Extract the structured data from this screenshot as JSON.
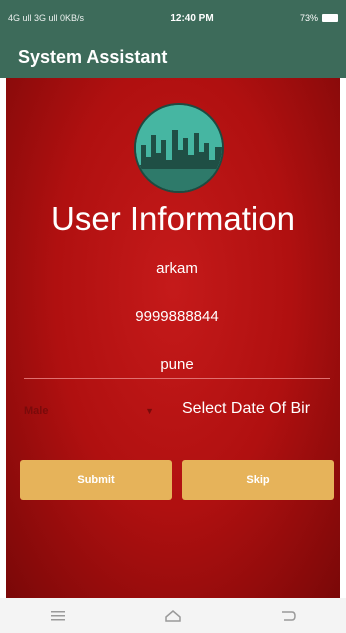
{
  "status_bar": {
    "left_text": "4G ull 3G ull 0KB/s",
    "time": "12:40 PM",
    "right_text": "73%"
  },
  "app_bar": {
    "title": "System Assistant"
  },
  "main": {
    "heading": "User Information",
    "name_value": "arkam",
    "phone_value": "9999888844",
    "city_value": "pune",
    "gender_selected": "Male",
    "dob_label": "Select Date Of Bir",
    "submit_label": "Submit",
    "skip_label": "Skip"
  }
}
